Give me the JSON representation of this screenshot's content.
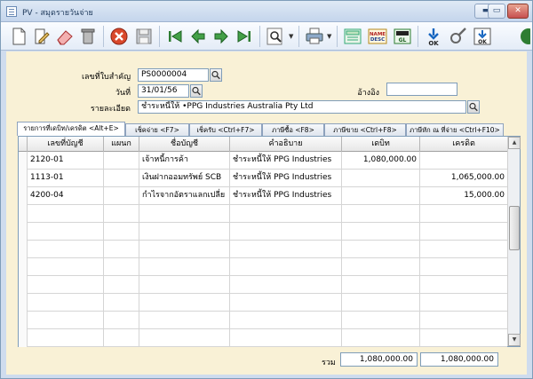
{
  "window": {
    "title": "PV - สมุดรายวันจ่าย",
    "controls": {
      "minimize": "▬",
      "maximize": "▭",
      "close": "✕"
    }
  },
  "toolbar": {
    "buttons": [
      {
        "icon": "new-document-icon"
      },
      {
        "icon": "edit-document-icon"
      },
      {
        "icon": "eraser-icon"
      },
      {
        "icon": "trash-icon"
      },
      {
        "icon": "cancel-icon"
      },
      {
        "icon": "save-icon"
      },
      {
        "icon": "first-record-icon"
      },
      {
        "icon": "previous-record-icon"
      },
      {
        "icon": "next-record-icon"
      },
      {
        "icon": "last-record-icon"
      },
      {
        "icon": "search-icon"
      },
      {
        "icon": "printer-icon"
      },
      {
        "icon": "calculator-icon"
      },
      {
        "icon": "name-desc-icon",
        "text": "NAME DESC"
      },
      {
        "icon": "gl-report-icon",
        "text": "GL"
      },
      {
        "icon": "ok-icon",
        "text": "OK"
      },
      {
        "icon": "tools-icon"
      },
      {
        "icon": "ok-box-icon",
        "text": "OK"
      }
    ]
  },
  "form": {
    "doc_no": {
      "label": "เลขที่ใบสำคัญ",
      "value": "PS0000004"
    },
    "date": {
      "label": "วันที่",
      "value": "31/01/56"
    },
    "reference": {
      "label": "อ้างอิง",
      "value": ""
    },
    "description": {
      "label": "รายละเอียด",
      "value": "ชำระหนี้ให้   •PPG Industries Australia Pty Ltd"
    }
  },
  "tabs": [
    "รายการที่เดบิท/เครดิต <Alt+E>",
    "เช็คจ่าย <F7>",
    "เช็ครับ <Ctrl+F7>",
    "ภาษีซื้อ <F8>",
    "ภาษีขาย <Ctrl+F8>",
    "ภาษีหัก ณ ที่จ่าย <Ctrl+F10>"
  ],
  "grid": {
    "columns": [
      "เลขที่บัญชี",
      "แผนก",
      "ชื่อบัญชี",
      "คำอธิบาย",
      "เดบิท",
      "เครดิต"
    ],
    "rows": [
      [
        "2120-01",
        "",
        "เจ้าหนี้การค้า",
        "ชำระหนี้ให้     PPG Industries",
        "1,080,000.00",
        ""
      ],
      [
        "1113-01",
        "",
        "เงินฝากออมทรัพย์ SCB",
        "ชำระหนี้ให้     PPG Industries",
        "",
        "1,065,000.00"
      ],
      [
        "4200-04",
        "",
        "กำไรจากอัตราแลกเปลี่ย",
        "ชำระหนี้ให้     PPG Industries",
        "",
        "15,000.00"
      ]
    ],
    "empty_rows": 8
  },
  "totals": {
    "label": "รวม",
    "debit": "1,080,000.00",
    "credit": "1,080,000.00"
  },
  "colors": {
    "form_bg": "#f9f1d6",
    "chrome_bg": "#cfdcee",
    "border": "#7f9db9"
  }
}
